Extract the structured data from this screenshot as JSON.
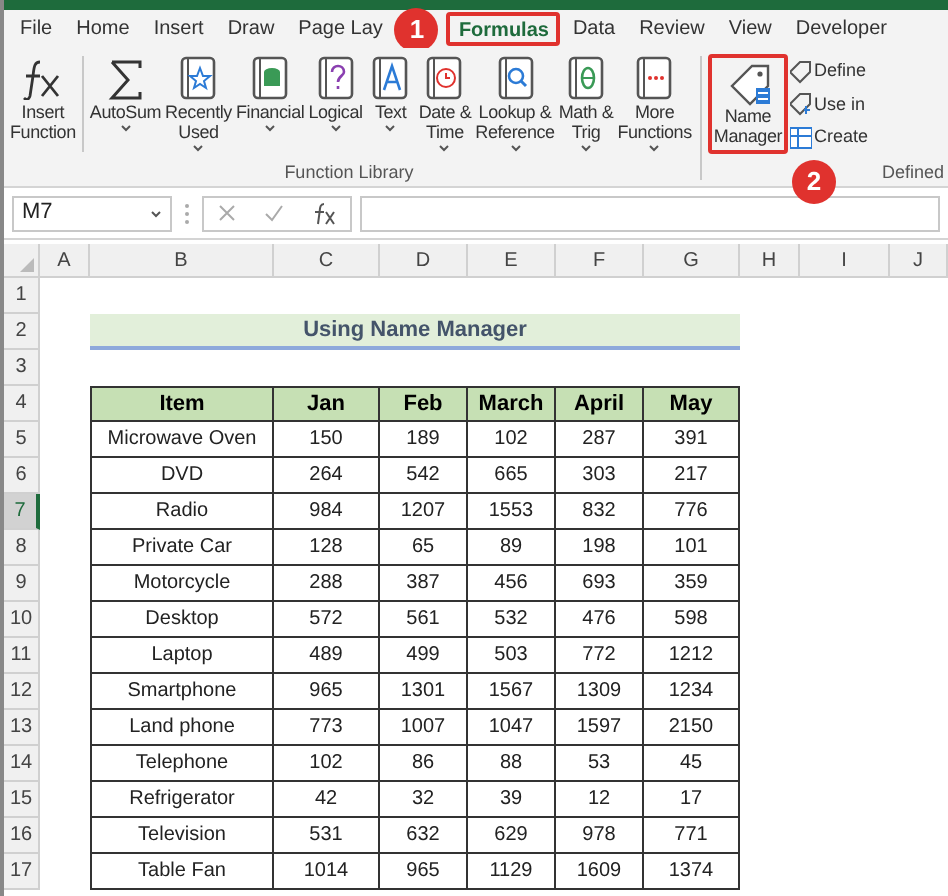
{
  "tabs": [
    {
      "label": "File",
      "selected": false
    },
    {
      "label": "Home",
      "selected": false
    },
    {
      "label": "Insert",
      "selected": false
    },
    {
      "label": "Draw",
      "selected": false
    },
    {
      "label": "Page Lay",
      "selected": false
    },
    {
      "label": "Formulas",
      "selected": true
    },
    {
      "label": "Data",
      "selected": false
    },
    {
      "label": "Review",
      "selected": false
    },
    {
      "label": "View",
      "selected": false
    },
    {
      "label": "Developer",
      "selected": false
    }
  ],
  "function_library": {
    "label": "Function Library",
    "buttons": [
      {
        "lines": [
          "Insert",
          "Function"
        ],
        "dropdown": false
      },
      {
        "lines": [
          "AutoSum"
        ],
        "dropdown": true
      },
      {
        "lines": [
          "Recently",
          "Used"
        ],
        "dropdown": true
      },
      {
        "lines": [
          "Financial"
        ],
        "dropdown": true
      },
      {
        "lines": [
          "Logical"
        ],
        "dropdown": true
      },
      {
        "lines": [
          "Text"
        ],
        "dropdown": true
      },
      {
        "lines": [
          "Date &",
          "Time"
        ],
        "dropdown": true
      },
      {
        "lines": [
          "Lookup &",
          "Reference"
        ],
        "dropdown": true
      },
      {
        "lines": [
          "Math &",
          "Trig"
        ],
        "dropdown": true
      },
      {
        "lines": [
          "More",
          "Functions"
        ],
        "dropdown": true
      }
    ]
  },
  "defined_names": {
    "label": "Defined",
    "button": {
      "lines": [
        "Name",
        "Manager"
      ]
    },
    "small_items": [
      "Define",
      "Use in",
      "Create"
    ]
  },
  "callouts": [
    {
      "label": "1"
    },
    {
      "label": "2"
    }
  ],
  "formula_bar": {
    "name_box": "M7"
  },
  "sheet": {
    "columns": [
      "A",
      "B",
      "C",
      "D",
      "E",
      "F",
      "G",
      "H",
      "I",
      "J"
    ],
    "rows": [
      {
        "label": "1",
        "selected": false
      },
      {
        "label": "2",
        "selected": false
      },
      {
        "label": "3",
        "selected": false
      },
      {
        "label": "4",
        "selected": false
      },
      {
        "label": "5",
        "selected": false
      },
      {
        "label": "6",
        "selected": false
      },
      {
        "label": "7",
        "selected": true
      },
      {
        "label": "8",
        "selected": false
      },
      {
        "label": "9",
        "selected": false
      },
      {
        "label": "10",
        "selected": false
      },
      {
        "label": "11",
        "selected": false
      },
      {
        "label": "12",
        "selected": false
      },
      {
        "label": "13",
        "selected": false
      },
      {
        "label": "14",
        "selected": false
      },
      {
        "label": "15",
        "selected": false
      },
      {
        "label": "16",
        "selected": false
      },
      {
        "label": "17",
        "selected": false
      }
    ],
    "title": "Using Name Manager",
    "table": {
      "columns": [
        "Item",
        "Jan",
        "Feb",
        "March",
        "April",
        "May"
      ],
      "rows": [
        [
          "Microwave Oven",
          "150",
          "189",
          "102",
          "287",
          "391"
        ],
        [
          "DVD",
          "264",
          "542",
          "665",
          "303",
          "217"
        ],
        [
          "Radio",
          "984",
          "1207",
          "1553",
          "832",
          "776"
        ],
        [
          "Private Car",
          "128",
          "65",
          "89",
          "198",
          "101"
        ],
        [
          "Motorcycle",
          "288",
          "387",
          "456",
          "693",
          "359"
        ],
        [
          "Desktop",
          "572",
          "561",
          "532",
          "476",
          "598"
        ],
        [
          "Laptop",
          "489",
          "499",
          "503",
          "772",
          "1212"
        ],
        [
          "Smartphone",
          "965",
          "1301",
          "1567",
          "1309",
          "1234"
        ],
        [
          "Land phone",
          "773",
          "1007",
          "1047",
          "1597",
          "2150"
        ],
        [
          "Telephone",
          "102",
          "86",
          "88",
          "53",
          "45"
        ],
        [
          "Refrigerator",
          "42",
          "32",
          "39",
          "12",
          "17"
        ],
        [
          "Television",
          "531",
          "632",
          "629",
          "978",
          "771"
        ],
        [
          "Table Fan",
          "1014",
          "965",
          "1129",
          "1609",
          "1374"
        ]
      ]
    }
  }
}
